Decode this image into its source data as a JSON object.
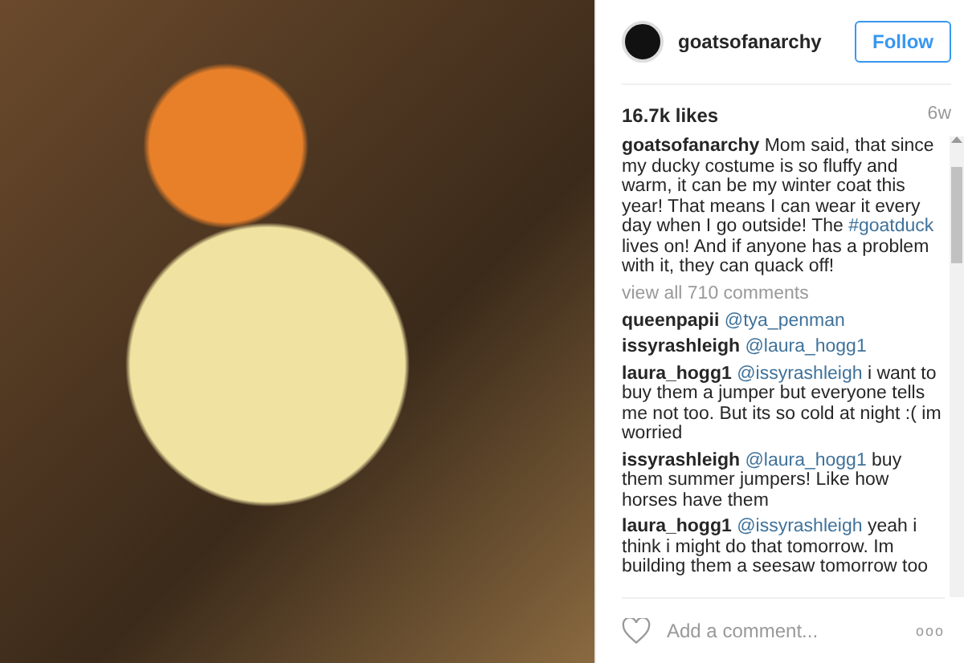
{
  "post": {
    "username": "goatsofanarchy",
    "follow_label": "Follow",
    "likes": "16.7k likes",
    "age": "6w"
  },
  "caption": {
    "user": "goatsofanarchy",
    "before": "Mom said, that since my ducky costume is so fluffy and warm, it can be my winter coat this year! That means I can wear it every day when I go outside! The ",
    "hashtag": "#goatduck",
    "after": " lives on! And if anyone has a problem with it, they can quack off!"
  },
  "view_all": "view all 710 comments",
  "comments": [
    {
      "user": "queenpapii",
      "mention": "@tya_penman"
    },
    {
      "user": "issyrashleigh",
      "mention": "@laura_hogg1"
    },
    {
      "user": "laura_hogg1",
      "mention": "@issyrashleigh",
      "text": " i want to buy them a jumper but everyone tells me not too. But its so cold at night :( im worried"
    },
    {
      "user": "issyrashleigh",
      "mention": "@laura_hogg1",
      "text": " buy them summer jumpers! Like how horses have them"
    },
    {
      "user": "laura_hogg1",
      "mention": "@issyrashleigh",
      "text": " yeah i think i might do that tomorrow. Im building them a seesaw tomorrow too"
    }
  ],
  "comment_box": {
    "placeholder": "Add a comment..."
  },
  "more_label": "ooo"
}
